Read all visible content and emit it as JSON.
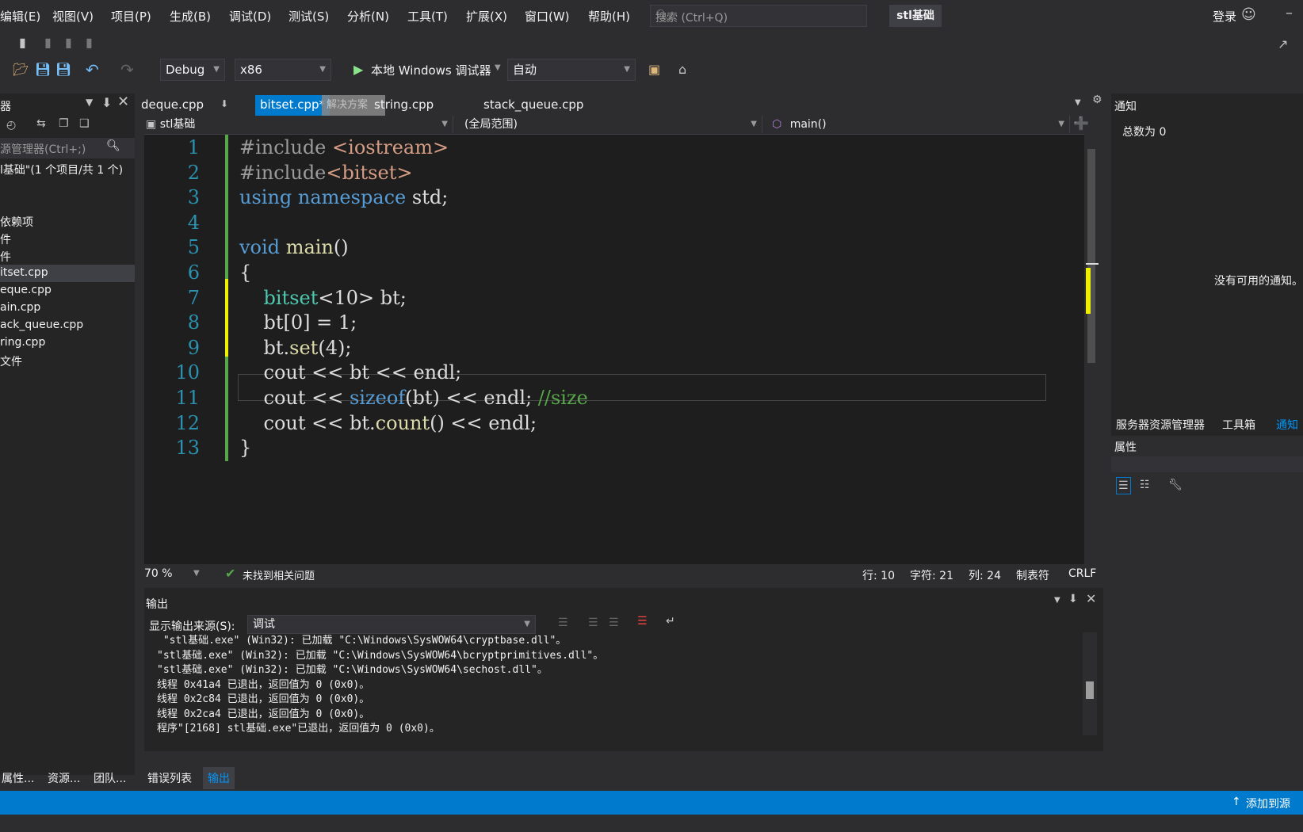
{
  "menu": [
    "编辑(E)",
    "视图(V)",
    "项目(P)",
    "生成(B)",
    "调试(D)",
    "测试(S)",
    "分析(N)",
    "工具(T)",
    "扩展(X)",
    "窗口(W)",
    "帮助(H)"
  ],
  "search": {
    "placeholder": "搜索 (Ctrl+Q)"
  },
  "solution_title": "stl基础",
  "signin": "登录",
  "toolbar": {
    "config": "Debug",
    "platform": "x86",
    "run_label": "本地 Windows 调试器",
    "auto": "自动"
  },
  "left_panel": {
    "title": "器",
    "search_placeholder": "源管理器(Ctrl+;)",
    "solution_line": "l基础\"(1 个项目/共 1 个)",
    "items": [
      "依赖项",
      "件",
      "件",
      "itset.cpp",
      "eque.cpp",
      "ain.cpp",
      "ack_queue.cpp",
      "ring.cpp",
      "文件"
    ]
  },
  "doc_tabs": [
    "deque.cpp",
    "bitset.cpp*",
    "string.cpp",
    "stack_queue.cpp"
  ],
  "tab_overlay": "解决方案",
  "nav": {
    "project": "stl基础",
    "scope": "(全局范围)",
    "member": "main()"
  },
  "code_lines": [
    {
      "n": "1",
      "html": "<span class='pp'>#include</span> <span class='str'>&lt;iostream&gt;</span>"
    },
    {
      "n": "2",
      "html": "<span class='pp'>#include</span><span class='str'>&lt;bitset&gt;</span>"
    },
    {
      "n": "3",
      "html": "<span class='kw'>using namespace</span> std;"
    },
    {
      "n": "4",
      "html": ""
    },
    {
      "n": "5",
      "html": "<span class='kw'>void</span> <span class='fn'>main</span>()"
    },
    {
      "n": "6",
      "html": "{"
    },
    {
      "n": "7",
      "html": "    <span class='ty'>bitset</span>&lt;10&gt; bt;"
    },
    {
      "n": "8",
      "html": "    bt[0] = 1;"
    },
    {
      "n": "9",
      "html": "    bt.<span class='fn'>set</span>(4);"
    },
    {
      "n": "10",
      "html": "    cout &lt;&lt; bt &lt;&lt; endl;"
    },
    {
      "n": "11",
      "html": "    cout &lt;&lt; <span class='kw'>sizeof</span>(bt) &lt;&lt; endl; <span class='cm'>//size</span>"
    },
    {
      "n": "12",
      "html": "    cout &lt;&lt; bt.<span class='fn'>count</span>() &lt;&lt; endl;"
    },
    {
      "n": "13",
      "html": "}"
    }
  ],
  "editor_status": {
    "zoom": "70 %",
    "issues": "未找到相关问题",
    "line": "行: 10",
    "char": "字符: 21",
    "col": "列: 24",
    "tab": "制表符",
    "eol": "CRLF"
  },
  "output": {
    "title": "输出",
    "source_label": "显示输出来源(S):",
    "source_value": "调试",
    "lines": [
      " \"stl基础.exe\" (Win32): 已加载 \"C:\\Windows\\SysWOW64\\cryptbase.dll\"。",
      "\"stl基础.exe\" (Win32): 已加载 \"C:\\Windows\\SysWOW64\\bcryptprimitives.dll\"。",
      "\"stl基础.exe\" (Win32): 已加载 \"C:\\Windows\\SysWOW64\\sechost.dll\"。",
      "线程 0x41a4 已退出，返回值为 0 (0x0)。",
      "线程 0x2c84 已退出，返回值为 0 (0x0)。",
      "线程 0x2ca4 已退出，返回值为 0 (0x0)。",
      "程序\"[2168] stl基础.exe\"已退出，返回值为 0 (0x0)。"
    ]
  },
  "bottom_tabs_left": [
    "属性...",
    "资源...",
    "团队..."
  ],
  "bottom_tabs": [
    "错误列表",
    "输出"
  ],
  "right_panel": {
    "title": "通知",
    "count": "总数为 0",
    "empty": "没有可用的通知。",
    "tabs": [
      "服务器资源管理器",
      "工具箱",
      "通知"
    ],
    "props_title": "属性"
  },
  "statusbar": {
    "right": "添加到源"
  }
}
